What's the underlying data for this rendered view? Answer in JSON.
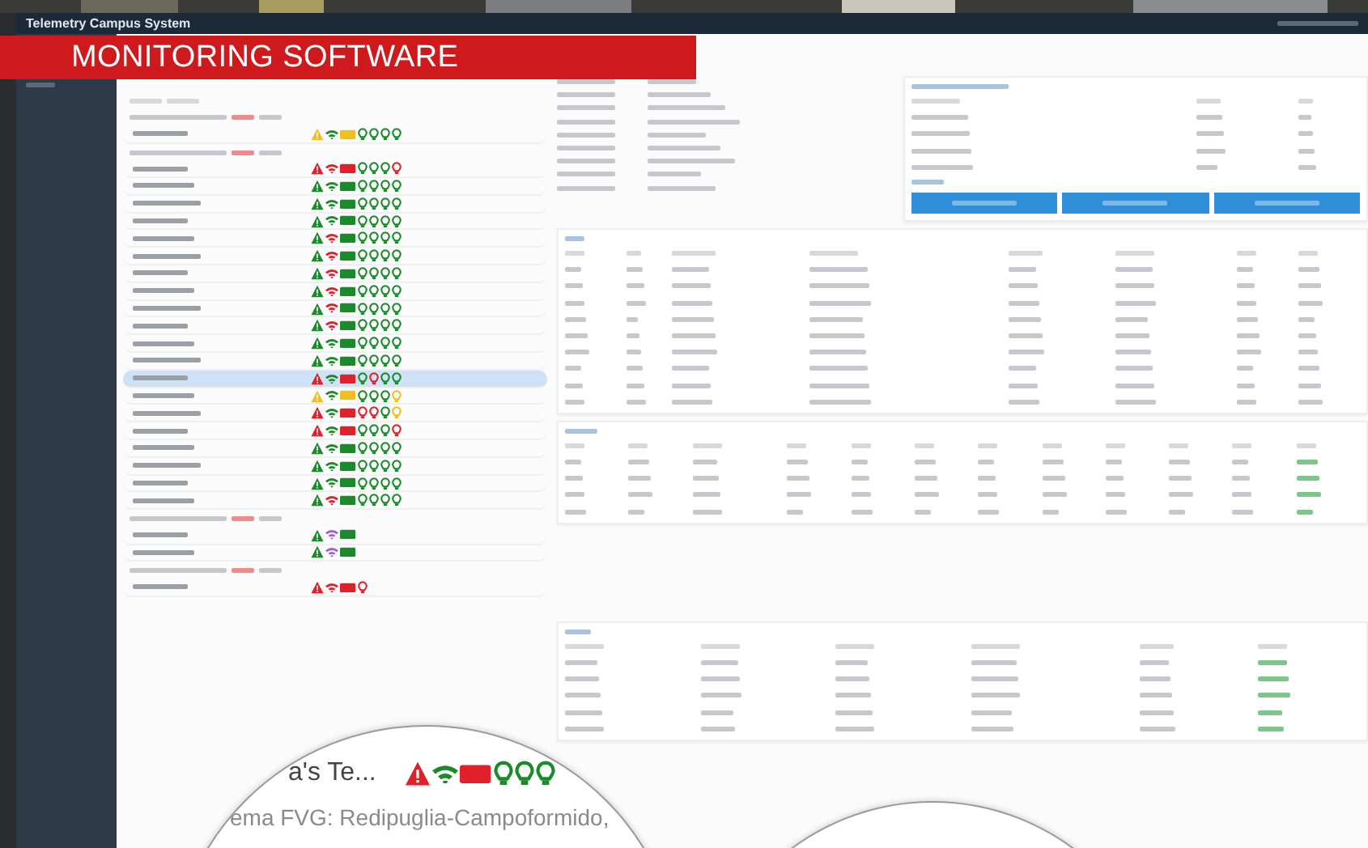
{
  "banner": {
    "title": "MONITORING SOFTWARE"
  },
  "window": {
    "title": "Telemetry Campus System"
  },
  "tree": {
    "groups": [
      {
        "rows": [
          {
            "selected": false,
            "icons": [
              {
                "kind": "alert",
                "color": "#f0c020"
              },
              {
                "kind": "wifi",
                "color": "#1a8a2a"
              },
              {
                "kind": "battery",
                "color": "#f0c020"
              },
              {
                "kind": "bulb",
                "color": "#1a8a2a"
              },
              {
                "kind": "bulb",
                "color": "#1a8a2a"
              },
              {
                "kind": "bulb",
                "color": "#1a8a2a"
              },
              {
                "kind": "bulb",
                "color": "#1a8a2a"
              }
            ]
          }
        ]
      },
      {
        "rows": [
          {
            "selected": false,
            "icons": [
              {
                "kind": "alert",
                "color": "#e0202a"
              },
              {
                "kind": "wifi",
                "color": "#e0202a"
              },
              {
                "kind": "battery",
                "color": "#e0202a"
              },
              {
                "kind": "bulb",
                "color": "#1a8a2a"
              },
              {
                "kind": "bulb",
                "color": "#1a8a2a"
              },
              {
                "kind": "bulb",
                "color": "#1a8a2a"
              },
              {
                "kind": "bulb",
                "color": "#e0202a"
              }
            ]
          },
          {
            "selected": false,
            "icons": [
              {
                "kind": "alert",
                "color": "#1a8a2a"
              },
              {
                "kind": "wifi",
                "color": "#1a8a2a"
              },
              {
                "kind": "battery",
                "color": "#1a8a2a"
              },
              {
                "kind": "bulb",
                "color": "#1a8a2a"
              },
              {
                "kind": "bulb",
                "color": "#1a8a2a"
              },
              {
                "kind": "bulb",
                "color": "#1a8a2a"
              },
              {
                "kind": "bulb",
                "color": "#1a8a2a"
              }
            ]
          },
          {
            "selected": false,
            "icons": [
              {
                "kind": "alert",
                "color": "#1a8a2a"
              },
              {
                "kind": "wifi",
                "color": "#1a8a2a"
              },
              {
                "kind": "battery",
                "color": "#1a8a2a"
              },
              {
                "kind": "bulb",
                "color": "#1a8a2a"
              },
              {
                "kind": "bulb",
                "color": "#1a8a2a"
              },
              {
                "kind": "bulb",
                "color": "#1a8a2a"
              },
              {
                "kind": "bulb",
                "color": "#1a8a2a"
              }
            ]
          },
          {
            "selected": false,
            "icons": [
              {
                "kind": "alert",
                "color": "#1a8a2a"
              },
              {
                "kind": "wifi",
                "color": "#1a8a2a"
              },
              {
                "kind": "battery",
                "color": "#1a8a2a"
              },
              {
                "kind": "bulb",
                "color": "#1a8a2a"
              },
              {
                "kind": "bulb",
                "color": "#1a8a2a"
              },
              {
                "kind": "bulb",
                "color": "#1a8a2a"
              },
              {
                "kind": "bulb",
                "color": "#1a8a2a"
              }
            ]
          },
          {
            "selected": false,
            "icons": [
              {
                "kind": "alert",
                "color": "#1a8a2a"
              },
              {
                "kind": "wifi",
                "color": "#e0202a"
              },
              {
                "kind": "battery",
                "color": "#1a8a2a"
              },
              {
                "kind": "bulb",
                "color": "#1a8a2a"
              },
              {
                "kind": "bulb",
                "color": "#1a8a2a"
              },
              {
                "kind": "bulb",
                "color": "#1a8a2a"
              },
              {
                "kind": "bulb",
                "color": "#1a8a2a"
              }
            ]
          },
          {
            "selected": false,
            "icons": [
              {
                "kind": "alert",
                "color": "#1a8a2a"
              },
              {
                "kind": "wifi",
                "color": "#e0202a"
              },
              {
                "kind": "battery",
                "color": "#1a8a2a"
              },
              {
                "kind": "bulb",
                "color": "#1a8a2a"
              },
              {
                "kind": "bulb",
                "color": "#1a8a2a"
              },
              {
                "kind": "bulb",
                "color": "#1a8a2a"
              },
              {
                "kind": "bulb",
                "color": "#1a8a2a"
              }
            ]
          },
          {
            "selected": false,
            "icons": [
              {
                "kind": "alert",
                "color": "#1a8a2a"
              },
              {
                "kind": "wifi",
                "color": "#e0202a"
              },
              {
                "kind": "battery",
                "color": "#1a8a2a"
              },
              {
                "kind": "bulb",
                "color": "#1a8a2a"
              },
              {
                "kind": "bulb",
                "color": "#1a8a2a"
              },
              {
                "kind": "bulb",
                "color": "#1a8a2a"
              },
              {
                "kind": "bulb",
                "color": "#1a8a2a"
              }
            ]
          },
          {
            "selected": false,
            "icons": [
              {
                "kind": "alert",
                "color": "#1a8a2a"
              },
              {
                "kind": "wifi",
                "color": "#e0202a"
              },
              {
                "kind": "battery",
                "color": "#1a8a2a"
              },
              {
                "kind": "bulb",
                "color": "#1a8a2a"
              },
              {
                "kind": "bulb",
                "color": "#1a8a2a"
              },
              {
                "kind": "bulb",
                "color": "#1a8a2a"
              },
              {
                "kind": "bulb",
                "color": "#1a8a2a"
              }
            ]
          },
          {
            "selected": false,
            "icons": [
              {
                "kind": "alert",
                "color": "#1a8a2a"
              },
              {
                "kind": "wifi",
                "color": "#e0202a"
              },
              {
                "kind": "battery",
                "color": "#1a8a2a"
              },
              {
                "kind": "bulb",
                "color": "#1a8a2a"
              },
              {
                "kind": "bulb",
                "color": "#1a8a2a"
              },
              {
                "kind": "bulb",
                "color": "#1a8a2a"
              },
              {
                "kind": "bulb",
                "color": "#1a8a2a"
              }
            ]
          },
          {
            "selected": false,
            "icons": [
              {
                "kind": "alert",
                "color": "#1a8a2a"
              },
              {
                "kind": "wifi",
                "color": "#e0202a"
              },
              {
                "kind": "battery",
                "color": "#1a8a2a"
              },
              {
                "kind": "bulb",
                "color": "#1a8a2a"
              },
              {
                "kind": "bulb",
                "color": "#1a8a2a"
              },
              {
                "kind": "bulb",
                "color": "#1a8a2a"
              },
              {
                "kind": "bulb",
                "color": "#1a8a2a"
              }
            ]
          },
          {
            "selected": false,
            "icons": [
              {
                "kind": "alert",
                "color": "#1a8a2a"
              },
              {
                "kind": "wifi",
                "color": "#1a8a2a"
              },
              {
                "kind": "battery",
                "color": "#1a8a2a"
              },
              {
                "kind": "bulb",
                "color": "#1a8a2a"
              },
              {
                "kind": "bulb",
                "color": "#1a8a2a"
              },
              {
                "kind": "bulb",
                "color": "#1a8a2a"
              },
              {
                "kind": "bulb",
                "color": "#1a8a2a"
              }
            ]
          },
          {
            "selected": false,
            "icons": [
              {
                "kind": "alert",
                "color": "#1a8a2a"
              },
              {
                "kind": "wifi",
                "color": "#1a8a2a"
              },
              {
                "kind": "battery",
                "color": "#1a8a2a"
              },
              {
                "kind": "bulb",
                "color": "#1a8a2a"
              },
              {
                "kind": "bulb",
                "color": "#1a8a2a"
              },
              {
                "kind": "bulb",
                "color": "#1a8a2a"
              },
              {
                "kind": "bulb",
                "color": "#1a8a2a"
              }
            ]
          },
          {
            "selected": true,
            "icons": [
              {
                "kind": "alert",
                "color": "#e0202a"
              },
              {
                "kind": "wifi",
                "color": "#1a8a2a"
              },
              {
                "kind": "battery",
                "color": "#e0202a"
              },
              {
                "kind": "bulb",
                "color": "#1a8a2a"
              },
              {
                "kind": "bulb",
                "color": "#e0202a"
              },
              {
                "kind": "bulb",
                "color": "#1a8a2a"
              },
              {
                "kind": "bulb",
                "color": "#1a8a2a"
              }
            ]
          },
          {
            "selected": false,
            "icons": [
              {
                "kind": "alert",
                "color": "#f0c020"
              },
              {
                "kind": "wifi",
                "color": "#1a8a2a"
              },
              {
                "kind": "battery",
                "color": "#f0c020"
              },
              {
                "kind": "bulb",
                "color": "#1a8a2a"
              },
              {
                "kind": "bulb",
                "color": "#1a8a2a"
              },
              {
                "kind": "bulb",
                "color": "#1a8a2a"
              },
              {
                "kind": "bulb",
                "color": "#f0c020"
              }
            ]
          },
          {
            "selected": false,
            "icons": [
              {
                "kind": "alert",
                "color": "#e0202a"
              },
              {
                "kind": "wifi",
                "color": "#1a8a2a"
              },
              {
                "kind": "battery",
                "color": "#e0202a"
              },
              {
                "kind": "bulb",
                "color": "#e0202a"
              },
              {
                "kind": "bulb",
                "color": "#e0202a"
              },
              {
                "kind": "bulb",
                "color": "#1a8a2a"
              },
              {
                "kind": "bulb",
                "color": "#f0c020"
              }
            ]
          },
          {
            "selected": false,
            "icons": [
              {
                "kind": "alert",
                "color": "#e0202a"
              },
              {
                "kind": "wifi",
                "color": "#1a8a2a"
              },
              {
                "kind": "battery",
                "color": "#e0202a"
              },
              {
                "kind": "bulb",
                "color": "#1a8a2a"
              },
              {
                "kind": "bulb",
                "color": "#1a8a2a"
              },
              {
                "kind": "bulb",
                "color": "#1a8a2a"
              },
              {
                "kind": "bulb",
                "color": "#e0202a"
              }
            ]
          },
          {
            "selected": false,
            "icons": [
              {
                "kind": "alert",
                "color": "#1a8a2a"
              },
              {
                "kind": "wifi",
                "color": "#1a8a2a"
              },
              {
                "kind": "battery",
                "color": "#1a8a2a"
              },
              {
                "kind": "bulb",
                "color": "#1a8a2a"
              },
              {
                "kind": "bulb",
                "color": "#1a8a2a"
              },
              {
                "kind": "bulb",
                "color": "#1a8a2a"
              },
              {
                "kind": "bulb",
                "color": "#1a8a2a"
              }
            ]
          },
          {
            "selected": false,
            "icons": [
              {
                "kind": "alert",
                "color": "#1a8a2a"
              },
              {
                "kind": "wifi",
                "color": "#1a8a2a"
              },
              {
                "kind": "battery",
                "color": "#1a8a2a"
              },
              {
                "kind": "bulb",
                "color": "#1a8a2a"
              },
              {
                "kind": "bulb",
                "color": "#1a8a2a"
              },
              {
                "kind": "bulb",
                "color": "#1a8a2a"
              },
              {
                "kind": "bulb",
                "color": "#1a8a2a"
              }
            ]
          },
          {
            "selected": false,
            "icons": [
              {
                "kind": "alert",
                "color": "#1a8a2a"
              },
              {
                "kind": "wifi",
                "color": "#1a8a2a"
              },
              {
                "kind": "battery",
                "color": "#1a8a2a"
              },
              {
                "kind": "bulb",
                "color": "#1a8a2a"
              },
              {
                "kind": "bulb",
                "color": "#1a8a2a"
              },
              {
                "kind": "bulb",
                "color": "#1a8a2a"
              },
              {
                "kind": "bulb",
                "color": "#1a8a2a"
              }
            ]
          },
          {
            "selected": false,
            "icons": [
              {
                "kind": "alert",
                "color": "#1a8a2a"
              },
              {
                "kind": "wifi",
                "color": "#e0202a"
              },
              {
                "kind": "battery",
                "color": "#1a8a2a"
              },
              {
                "kind": "bulb",
                "color": "#1a8a2a"
              },
              {
                "kind": "bulb",
                "color": "#1a8a2a"
              },
              {
                "kind": "bulb",
                "color": "#1a8a2a"
              },
              {
                "kind": "bulb",
                "color": "#1a8a2a"
              }
            ]
          }
        ]
      },
      {
        "rows": [
          {
            "selected": false,
            "icons": [
              {
                "kind": "alert",
                "color": "#1a8a2a"
              },
              {
                "kind": "wifi",
                "color": "#a060d0"
              },
              {
                "kind": "battery",
                "color": "#1a8a2a"
              }
            ]
          },
          {
            "selected": false,
            "icons": [
              {
                "kind": "alert",
                "color": "#1a8a2a"
              },
              {
                "kind": "wifi",
                "color": "#a060d0"
              },
              {
                "kind": "battery",
                "color": "#1a8a2a"
              }
            ]
          }
        ]
      },
      {
        "rows": [
          {
            "selected": false,
            "icons": [
              {
                "kind": "alert",
                "color": "#e0202a"
              },
              {
                "kind": "wifi",
                "color": "#e0202a"
              },
              {
                "kind": "battery",
                "color": "#e0202a"
              },
              {
                "kind": "bulb",
                "color": "#e0202a"
              }
            ]
          }
        ]
      }
    ]
  },
  "magnifier": {
    "name": "a's Te...",
    "icons": [
      {
        "kind": "alert",
        "color": "#e0202a"
      },
      {
        "kind": "wifi",
        "color": "#1a8a2a"
      },
      {
        "kind": "battery",
        "color": "#e0202a"
      },
      {
        "kind": "bulb",
        "color": "#1a8a2a"
      },
      {
        "kind": "bulb",
        "color": "#1a8a2a"
      },
      {
        "kind": "bulb",
        "color": "#1a8a2a"
      }
    ],
    "line": "ema FVG: Redipuglia-Campoformido,"
  }
}
